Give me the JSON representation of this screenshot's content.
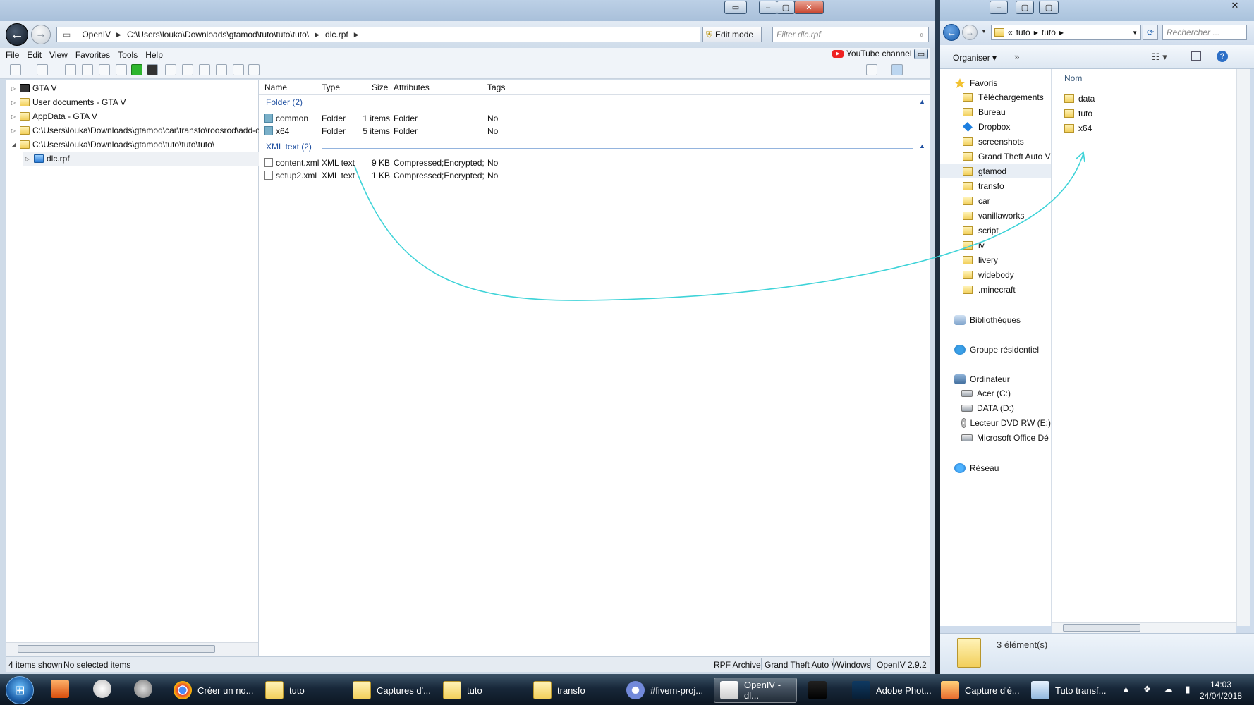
{
  "openiv": {
    "address": [
      "OpenIV",
      "C:\\Users\\louka\\Downloads\\gtamod\\tuto\\tuto\\tuto\\",
      "dlc.rpf"
    ],
    "edit_mode": "Edit mode",
    "filter_placeholder": "Filter dlc.rpf",
    "menu": [
      "File",
      "Edit",
      "View",
      "Favorites",
      "Tools",
      "Help"
    ],
    "youtube": "YouTube channel",
    "tree": [
      {
        "label": "GTA V",
        "expander": "▷",
        "icon": "gta-icon",
        "indent": 0
      },
      {
        "label": "User documents - GTA V",
        "expander": "▷",
        "icon": "folder-icon",
        "indent": 0
      },
      {
        "label": "AppData - GTA V",
        "expander": "▷",
        "icon": "folder-icon",
        "indent": 0
      },
      {
        "label": "C:\\Users\\louka\\Downloads\\gtamod\\car\\transfo\\roosrod\\add-on s",
        "expander": "▷",
        "icon": "folder-icon",
        "indent": 0
      },
      {
        "label": "C:\\Users\\louka\\Downloads\\gtamod\\tuto\\tuto\\tuto\\",
        "expander": "◢",
        "icon": "folder-icon",
        "indent": 0
      },
      {
        "label": "dlc.rpf",
        "expander": "▷",
        "icon": "rpf-icon",
        "indent": 1
      }
    ],
    "columns": [
      "Name",
      "Type",
      "Size",
      "Attributes",
      "Tags"
    ],
    "groups": [
      {
        "title": "Folder (2)",
        "rows": [
          {
            "name": "common",
            "type": "Folder",
            "size": "1 items",
            "attributes": "Folder",
            "tags": "No"
          },
          {
            "name": "x64",
            "type": "Folder",
            "size": "5 items",
            "attributes": "Folder",
            "tags": "No"
          }
        ]
      },
      {
        "title": "XML text (2)",
        "rows": [
          {
            "name": "content.xml",
            "type": "XML text",
            "size": "9 KB",
            "attributes": "Compressed;Encrypted;",
            "tags": "No"
          },
          {
            "name": "setup2.xml",
            "type": "XML text",
            "size": "1 KB",
            "attributes": "Compressed;Encrypted;",
            "tags": "No"
          }
        ]
      }
    ],
    "status": {
      "shown": "4 items shown",
      "selected": "No selected items",
      "archive": "RPF Archive",
      "game": "Grand Theft Auto V",
      "platform": "Windows",
      "version": "OpenIV 2.9.2"
    }
  },
  "explorer": {
    "address": [
      "«",
      "tuto",
      "tuto"
    ],
    "search_placeholder": "Rechercher ...",
    "organize": "Organiser",
    "more": "»",
    "column": "Nom",
    "nav": [
      {
        "label": "Favoris",
        "kind": "header",
        "icon": "star-icon"
      },
      {
        "label": "Téléchargements",
        "kind": "item",
        "icon": "folder-icon"
      },
      {
        "label": "Bureau",
        "kind": "item",
        "icon": "folder-icon"
      },
      {
        "label": "Dropbox",
        "kind": "item",
        "icon": "dropbox-icon"
      },
      {
        "label": "screenshots",
        "kind": "item",
        "icon": "folder-icon"
      },
      {
        "label": "Grand Theft Auto V",
        "kind": "item",
        "icon": "folder-icon"
      },
      {
        "label": "gtamod",
        "kind": "item",
        "icon": "folder-icon",
        "selected": true
      },
      {
        "label": "transfo",
        "kind": "item",
        "icon": "folder-icon"
      },
      {
        "label": "car",
        "kind": "item",
        "icon": "folder-icon"
      },
      {
        "label": "vanillaworks",
        "kind": "item",
        "icon": "folder-icon"
      },
      {
        "label": "script",
        "kind": "item",
        "icon": "folder-icon"
      },
      {
        "label": "iv",
        "kind": "item",
        "icon": "folder-icon"
      },
      {
        "label": "livery",
        "kind": "item",
        "icon": "folder-icon"
      },
      {
        "label": "widebody",
        "kind": "item",
        "icon": "folder-icon"
      },
      {
        "label": ".minecraft",
        "kind": "item",
        "icon": "folder-icon"
      },
      {
        "label": "Bibliothèques",
        "kind": "header",
        "icon": "library-icon"
      },
      {
        "label": "Groupe résidentiel",
        "kind": "header",
        "icon": "homegroup-icon"
      },
      {
        "label": "Ordinateur",
        "kind": "header",
        "icon": "computer-icon"
      },
      {
        "label": "Acer (C:)",
        "kind": "drive",
        "icon": "drive-icon"
      },
      {
        "label": "DATA (D:)",
        "kind": "drive",
        "icon": "drive-icon"
      },
      {
        "label": "Lecteur DVD RW (E:)",
        "kind": "drive",
        "icon": "dvd-icon"
      },
      {
        "label": "Microsoft Office Dé",
        "kind": "drive",
        "icon": "drive-icon"
      },
      {
        "label": "Réseau",
        "kind": "header",
        "icon": "network-icon"
      }
    ],
    "items": [
      "data",
      "tuto",
      "x64"
    ],
    "details": "3 élément(s)"
  },
  "taskbar": {
    "tasks": [
      {
        "label": "Créer un no...",
        "icon": "chrome-icon"
      },
      {
        "label": "tuto",
        "icon": "folder-icon"
      },
      {
        "label": "Captures d'...",
        "icon": "folder-icon"
      },
      {
        "label": "tuto",
        "icon": "folder-icon"
      },
      {
        "label": "transfo",
        "icon": "folder-icon"
      },
      {
        "label": "#fivem-proj...",
        "icon": "discord-icon"
      },
      {
        "label": "OpenIV - dl...",
        "icon": "openiv-icon"
      },
      {
        "label": "",
        "icon": "wrench-icon"
      },
      {
        "label": "Adobe Phot...",
        "icon": "photoshop-icon"
      },
      {
        "label": "Capture d'é...",
        "icon": "snipping-icon"
      },
      {
        "label": "Tuto transf...",
        "icon": "notepad-icon"
      }
    ],
    "time": "14:03",
    "date": "24/04/2018"
  },
  "colors": {
    "annotation": "#3ed3d8",
    "group": "#1e4fa0"
  }
}
